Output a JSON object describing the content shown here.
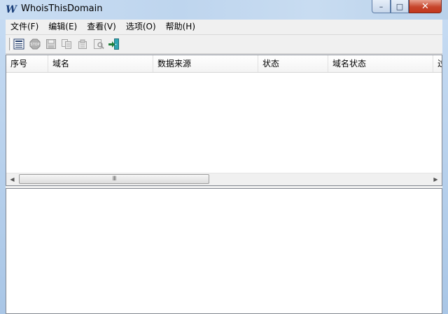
{
  "window": {
    "title": "WhoisThisDomain",
    "app_icon_glyph": "W"
  },
  "window_controls": {
    "minimize": "–",
    "maximize": "□",
    "close": "✕"
  },
  "menu": [
    {
      "label": "文件(F)"
    },
    {
      "label": "编辑(E)"
    },
    {
      "label": "查看(V)"
    },
    {
      "label": "选项(O)"
    },
    {
      "label": "帮助(H)"
    }
  ],
  "toolbar": [
    {
      "name": "list-view-icon",
      "enabled": true
    },
    {
      "name": "stop-icon",
      "enabled": false
    },
    {
      "name": "save-icon",
      "enabled": false
    },
    {
      "name": "copy-icon",
      "enabled": false
    },
    {
      "name": "properties-icon",
      "enabled": false
    },
    {
      "name": "find-icon",
      "enabled": false
    },
    {
      "name": "exit-icon",
      "enabled": true
    }
  ],
  "table": {
    "columns": [
      "序号",
      "域名",
      "数据来源",
      "状态",
      "域名状态",
      "过"
    ],
    "rows": []
  },
  "scrollbar": {
    "thumb_grip": "III",
    "left_arrow": "◀",
    "right_arrow": "▶"
  }
}
